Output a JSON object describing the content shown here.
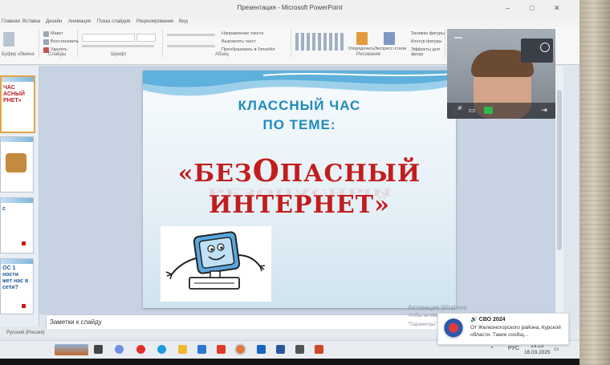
{
  "window": {
    "title": "Презентация - Microsoft PowerPoint",
    "minimize": "–",
    "maximize": "□",
    "close": "✕"
  },
  "ribbon": {
    "tabs": [
      "Главная",
      "Вставка",
      "Дизайн",
      "Анимация",
      "Показ слайдов",
      "Рецензирование",
      "Вид"
    ],
    "groups": [
      "Буфер обмена",
      "Слайды",
      "Шрифт",
      "Абзац",
      "Рисование",
      "Редактирование"
    ],
    "items": [
      "Макет",
      "Восстановить",
      "Удалить",
      "Направление текста",
      "Выровнять текст",
      "Преобразовать в SmartArt",
      "Упорядочить",
      "Экспресс-стили",
      "Заливка фигуры",
      "Контур фигуры",
      "Эффекты для фигур"
    ]
  },
  "slides": {
    "thumbs": [
      {
        "text": "ЧАС\nАСНЫЙ\nРНЕТ»"
      },
      {
        "text": ""
      },
      {
        "text": "с"
      },
      {
        "text": "ОС 1\nности\nжет нас в\nсети?"
      }
    ]
  },
  "slide": {
    "line1": "КЛАССНЫЙ ЧАС",
    "line2": "ПО ТЕМЕ:",
    "line3_pre": "«БЕЗ",
    "line3_o": "О",
    "line3_post": "ПАСНЫЙ",
    "line4": "ИНТЕРНЕТ»",
    "reflection": "БЕЗОПАСНЫЙ"
  },
  "notes": {
    "placeholder": "Заметки к слайду"
  },
  "statusbar": {
    "language": "Русский (Россия)"
  },
  "activation": {
    "line1": "Активация Windows",
    "line2": "Чтобы активировать Windows, перейдите в раздел",
    "line3": "\"Параметры\"."
  },
  "toast": {
    "title": "🔊 СВО 2024",
    "body": "От Железногорского района, Курской области. Такие сообщ..."
  },
  "taskbar": {
    "lang": "РУС",
    "time": "13:23",
    "date": "16.03.2025"
  },
  "colors": {
    "slide_title_blue": "#1d8bbf",
    "slide_title_red": "#c21d1d",
    "call_green": "#2fb84d"
  }
}
